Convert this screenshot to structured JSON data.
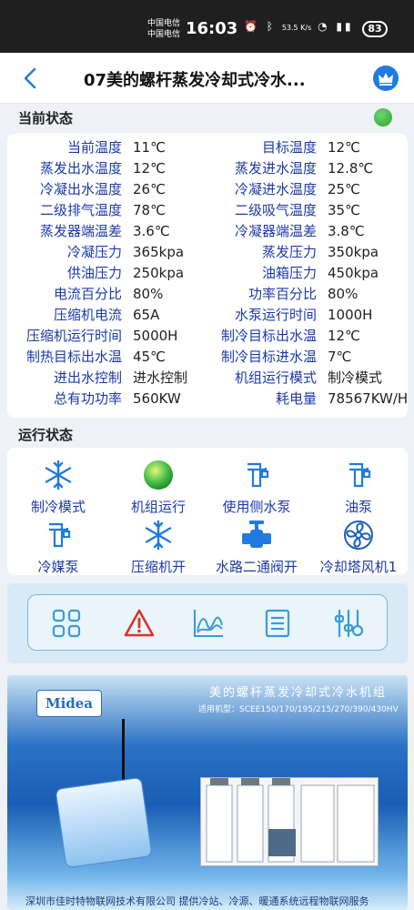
{
  "statusbar": {
    "carrier1": "中国电信",
    "carrier2": "中国电信",
    "time": "16:03",
    "speed": "53.5 K/s",
    "battery": "83"
  },
  "header": {
    "title": "07美的螺杆蒸发冷却式冷水..."
  },
  "sections": {
    "current": "当前状态",
    "running": "运行状态"
  },
  "params": [
    {
      "l_label": "当前温度",
      "l_value": "11℃",
      "r_label": "目标温度",
      "r_value": "12℃"
    },
    {
      "l_label": "蒸发出水温度",
      "l_value": "12℃",
      "r_label": "蒸发进水温度",
      "r_value": "12.8℃"
    },
    {
      "l_label": "冷凝出水温度",
      "l_value": "26℃",
      "r_label": "冷凝进水温度",
      "r_value": "25℃"
    },
    {
      "l_label": "二级排气温度",
      "l_value": "78℃",
      "r_label": "二级吸气温度",
      "r_value": "35℃"
    },
    {
      "l_label": "蒸发器端温差",
      "l_value": "3.6℃",
      "r_label": "冷凝器端温差",
      "r_value": "3.8℃"
    },
    {
      "l_label": "冷凝压力",
      "l_value": "365kpa",
      "r_label": "蒸发压力",
      "r_value": "350kpa"
    },
    {
      "l_label": "供油压力",
      "l_value": "250kpa",
      "r_label": "油箱压力",
      "r_value": "450kpa"
    },
    {
      "l_label": "电流百分比",
      "l_value": "80%",
      "r_label": "功率百分比",
      "r_value": "80%"
    },
    {
      "l_label": "压缩机电流",
      "l_value": "65A",
      "r_label": "水泵运行时间",
      "r_value": "1000H"
    },
    {
      "l_label": "压缩机运行时间",
      "l_value": "5000H",
      "r_label": "制冷目标出水温",
      "r_value": "12℃"
    },
    {
      "l_label": "制热目标出水温",
      "l_value": "45℃",
      "r_label": "制冷目标进水温",
      "r_value": "7℃"
    },
    {
      "l_label": "进出水控制",
      "l_value": "进水控制",
      "r_label": "机组运行模式",
      "r_value": "制冷模式"
    },
    {
      "l_label": "总有功功率",
      "l_value": "560KW",
      "r_label": "耗电量",
      "r_value": "78567KW/H"
    }
  ],
  "states": [
    {
      "label": "制冷模式",
      "icon": "snowflake-icon"
    },
    {
      "label": "机组运行",
      "icon": "green-ball-icon"
    },
    {
      "label": "使用侧水泵",
      "icon": "pump-icon"
    },
    {
      "label": "油泵",
      "icon": "pump-icon"
    },
    {
      "label": "冷媒泵",
      "icon": "pump-icon"
    },
    {
      "label": "压缩机开",
      "icon": "snowflake-icon"
    },
    {
      "label": "水路二通阀开",
      "icon": "valve-icon"
    },
    {
      "label": "冷却塔风机1",
      "icon": "fan-icon"
    }
  ],
  "nav": [
    "grid-icon",
    "warning-icon",
    "chart-icon",
    "list-icon",
    "settings-icon"
  ],
  "banner": {
    "logo": "Midea",
    "title": "美的螺杆蒸发冷却式冷水机组",
    "subtitle": "适用机型：SCEE150/170/195/215/270/390/430HV",
    "footer": "深圳市佳时特物联网技术有限公司 提供冷站、冷源、暖通系统远程物联网服务"
  },
  "colors": {
    "label_blue": "#1d3aa8",
    "accent_blue": "#1f7be0",
    "running_green": "#2ea52e",
    "status_bar": "#1f1f1f"
  }
}
